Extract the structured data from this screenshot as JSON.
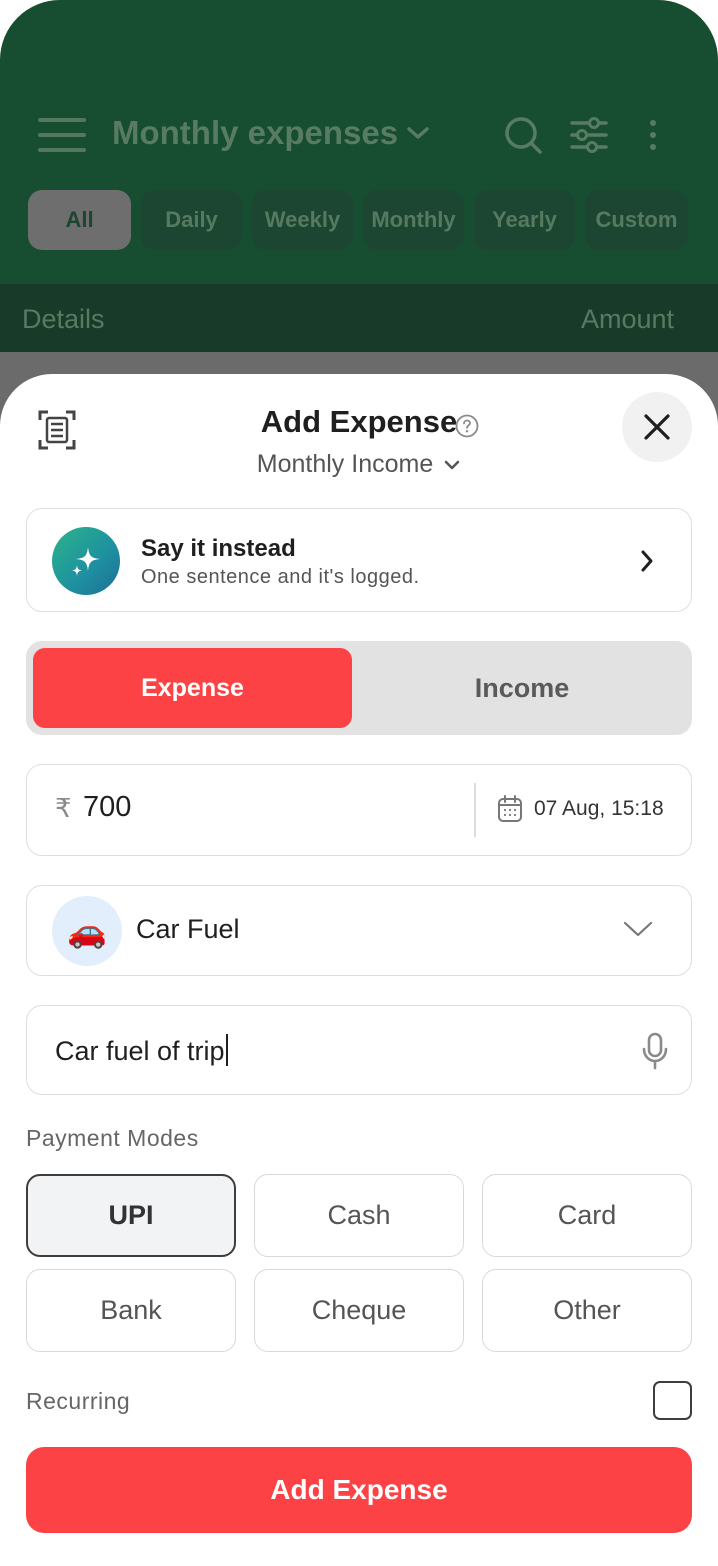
{
  "background": {
    "title": "Monthly expenses",
    "filters": [
      "All",
      "Daily",
      "Weekly",
      "Monthly",
      "Yearly",
      "Custom"
    ],
    "active_filter": "All",
    "table_header": {
      "details": "Details",
      "amount": "Amount"
    },
    "colors": {
      "header": "#174d30",
      "table_header": "#173b28"
    }
  },
  "sheet": {
    "title": "Add Expense",
    "account": "Monthly Income",
    "say_card": {
      "title": "Say it instead",
      "subtitle": "One sentence and it's logged."
    },
    "type_toggle": {
      "expense": "Expense",
      "income": "Income",
      "selected": "Expense"
    },
    "amount": {
      "currency_symbol": "₹",
      "value": "700"
    },
    "date": "07 Aug, 15:18",
    "category": {
      "emoji": "🚗",
      "name": "Car Fuel"
    },
    "note": {
      "value": "Car fuel of trip"
    },
    "payment_modes_label": "Payment Modes",
    "payment_modes": [
      "UPI",
      "Cash",
      "Card",
      "Bank",
      "Cheque",
      "Other"
    ],
    "selected_payment_mode": "UPI",
    "recurring_label": "Recurring",
    "recurring_checked": false,
    "submit_label": "Add Expense",
    "colors": {
      "accent": "#fc4244",
      "toggle_bg": "#e2e2e2"
    }
  },
  "icons": {
    "scan": "receipt-scan-icon",
    "help": "help-circle-icon",
    "close": "close-icon",
    "sparkle": "sparkle-icon",
    "calendar": "calendar-icon",
    "mic": "microphone-icon"
  }
}
